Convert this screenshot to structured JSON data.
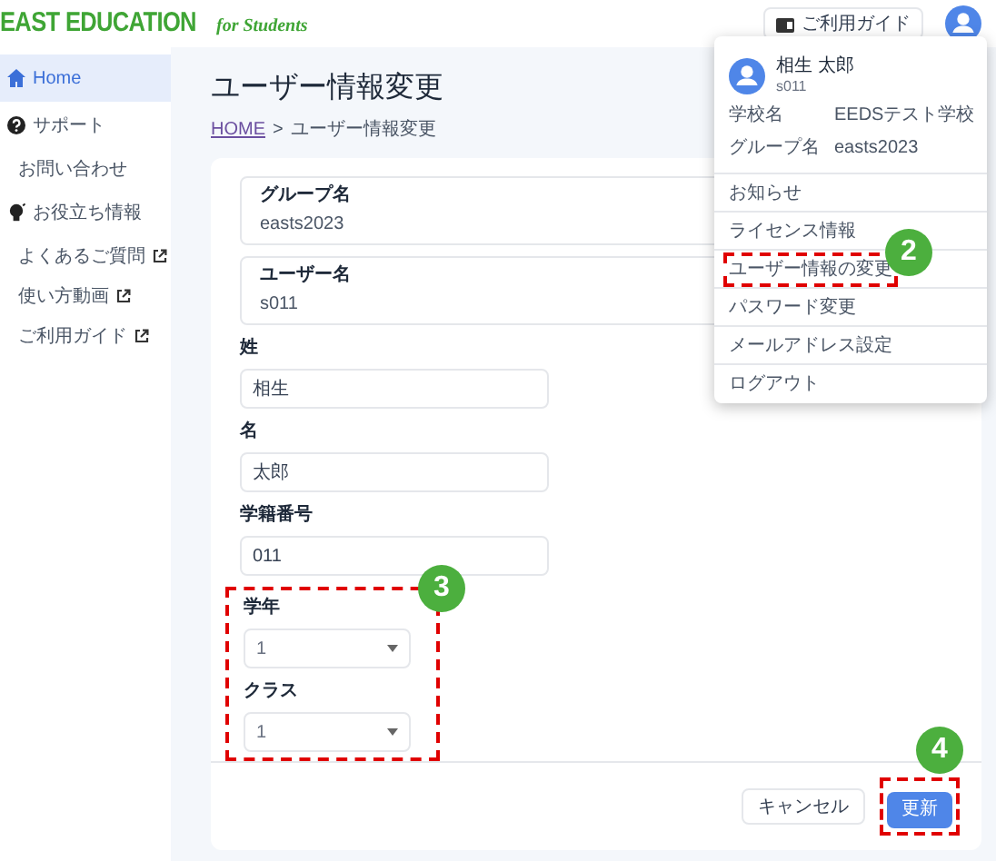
{
  "header": {
    "logo": "EAST EDUCATION",
    "logo_sub": "for Students",
    "guide_button": "ご利用ガイド"
  },
  "sidebar": {
    "items": [
      {
        "label": "Home",
        "kind": "main",
        "selected": true
      },
      {
        "label": "サポート",
        "kind": "main",
        "selected": false
      },
      {
        "label": "お問い合わせ",
        "kind": "sub",
        "external": false,
        "selected": false
      },
      {
        "label": "お役立ち情報",
        "kind": "main",
        "selected": false
      },
      {
        "label": "よくあるご質問",
        "kind": "sub",
        "external": true,
        "selected": false
      },
      {
        "label": "使い方動画",
        "kind": "sub",
        "external": true,
        "selected": false
      },
      {
        "label": "ご利用ガイド",
        "kind": "sub",
        "external": true,
        "selected": false
      }
    ]
  },
  "page": {
    "title": "ユーザー情報変更",
    "separator": ">",
    "breadcrumb": [
      {
        "label": "HOME",
        "link": true
      },
      {
        "label": "ユーザー情報変更",
        "link": false
      }
    ]
  },
  "form": {
    "fields": [
      {
        "kind": "readonly",
        "label": "グループ名",
        "value": "easts2023"
      },
      {
        "kind": "readonly",
        "label": "ユーザー名",
        "value": "s011"
      },
      {
        "kind": "text",
        "label": "姓",
        "value": "相生"
      },
      {
        "kind": "text",
        "label": "名",
        "value": "太郎"
      },
      {
        "kind": "text",
        "label": "学籍番号",
        "value": "011"
      },
      {
        "kind": "select",
        "label": "学年",
        "value": "1"
      },
      {
        "kind": "select",
        "label": "クラス",
        "value": "1"
      }
    ],
    "select_group": {
      "highlighted": true,
      "callout": "3"
    },
    "buttons": [
      {
        "label": "キャンセル",
        "kind": "outline",
        "highlighted": false
      },
      {
        "label": "更新",
        "kind": "primary",
        "highlighted": true,
        "callout": "4"
      }
    ]
  },
  "user_menu": {
    "name": "相生 太郎",
    "user_id": "s011",
    "info": [
      {
        "label": "学校名",
        "value": "EEDSテスト学校"
      },
      {
        "label": "グループ名",
        "value": "easts2023"
      }
    ],
    "items": [
      {
        "label": "お知らせ",
        "highlighted": false
      },
      {
        "label": "ライセンス情報",
        "highlighted": false
      },
      {
        "label": "ユーザー情報の変更",
        "highlighted": true,
        "callout": "2"
      },
      {
        "label": "パスワード変更",
        "highlighted": false
      },
      {
        "label": "メールアドレス設定",
        "highlighted": false
      },
      {
        "label": "ログアウト",
        "highlighted": false
      }
    ]
  }
}
